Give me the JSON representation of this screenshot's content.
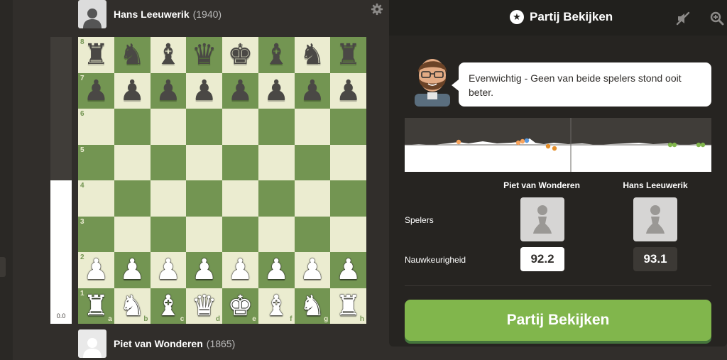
{
  "top_player": {
    "name": "Hans Leeuwerik",
    "rating": "(1940)"
  },
  "bottom_player": {
    "name": "Piet van Wonderen",
    "rating": "(1865)"
  },
  "eval_bar": {
    "value": "0.0",
    "white_share": 0.5
  },
  "board": {
    "files": [
      "a",
      "b",
      "c",
      "d",
      "e",
      "f",
      "g",
      "h"
    ],
    "ranks": [
      "8",
      "7",
      "6",
      "5",
      "4",
      "3",
      "2",
      "1"
    ],
    "pieces": [
      [
        "♜",
        "♞",
        "♝",
        "♛",
        "♚",
        "♝",
        "♞",
        "♜"
      ],
      [
        "♟",
        "♟",
        "♟",
        "♟",
        "♟",
        "♟",
        "♟",
        "♟"
      ],
      [
        "",
        "",
        "",
        "",
        "",
        "",
        "",
        ""
      ],
      [
        "",
        "",
        "",
        "",
        "",
        "",
        "",
        ""
      ],
      [
        "",
        "",
        "",
        "",
        "",
        "",
        "",
        ""
      ],
      [
        "",
        "",
        "",
        "",
        "",
        "",
        "",
        ""
      ],
      [
        "♟",
        "♟",
        "♟",
        "♟",
        "♟",
        "♟",
        "♟",
        "♟"
      ],
      [
        "♜",
        "♞",
        "♝",
        "♛",
        "♚",
        "♝",
        "♞",
        "♜"
      ]
    ]
  },
  "panel": {
    "title": "Partij Bekijken",
    "coach_message": "Evenwichtig - Geen van beide spelers stond ooit beter.",
    "white_player": "Piet van Wonderen",
    "black_player": "Hans Leeuwerik",
    "players_label": "Spelers",
    "accuracy_label": "Nauwkeurigheid",
    "white_accuracy": "92.2",
    "black_accuracy": "93.1",
    "button_label": "Partij Bekijken"
  },
  "colors": {
    "accent_green": "#81b64c",
    "board_light": "#ebecd0",
    "board_dark": "#739552",
    "inaccuracy": "#f7a35c",
    "mistake": "#e58f2a",
    "best": "#5c9ade",
    "great": "#81b64c"
  },
  "icons": [
    "gear-icon",
    "star-icon",
    "mute-icon",
    "zoom-icon",
    "pawn-icon"
  ]
}
